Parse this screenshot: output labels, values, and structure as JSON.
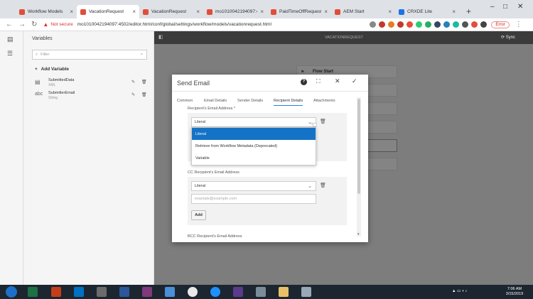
{
  "browser": {
    "tabs": [
      {
        "label": "Workflow Models",
        "color": "#e04e39"
      },
      {
        "label": "VacationRequest",
        "color": "#e04e39"
      },
      {
        "label": "VacationRequest",
        "color": "#e04e39"
      },
      {
        "label": "mo1010042194097:4",
        "color": "#e04e39"
      },
      {
        "label": "PaidTimeOffRequest",
        "color": "#e04e39"
      },
      {
        "label": "AEM Start",
        "color": "#e04e39"
      },
      {
        "label": "CRXDE Lite",
        "color": "#1a73e8"
      }
    ],
    "new_tab": "+",
    "security_label": "Not secure",
    "url": "mo1010042194097:4502/editor.html/conf/global/settings/workflow/models/vacationrequest.html",
    "error_label": "Error"
  },
  "left_panel": {
    "title": "Variables",
    "filter_placeholder": "Filter",
    "add_variable": "Add Variable",
    "variables": [
      {
        "name": "SubmittedData",
        "type": "XML"
      },
      {
        "name": "SubmitterEmail",
        "type": "String"
      }
    ]
  },
  "canvas": {
    "header_title": "VACATIONREQUEST",
    "sync_label": "Sync",
    "flow_start": "Flow Start"
  },
  "dialog": {
    "title": "Send Email",
    "tabs": [
      "Common",
      "Email Details",
      "Sender Details",
      "Recipient Details",
      "Attachments"
    ],
    "active_tab": "Recipient Details",
    "recipient_label": "Recipient's Email Address *",
    "recipient_value": "Literal",
    "dropdown_options": [
      "Literal",
      "Retrieve from Workflow Metadata (Deprecated)",
      "Variable"
    ],
    "cc_label": "CC Recipient's Email Address",
    "cc_value": "Literal",
    "cc_placeholder": "example@example.com",
    "add_button": "Add",
    "bcc_label": "BCC Recipient's Email Address"
  },
  "taskbar": {
    "time": "7:06 AM",
    "date": "3/15/2019"
  }
}
